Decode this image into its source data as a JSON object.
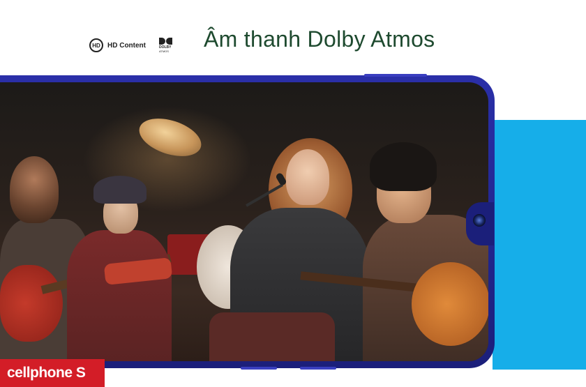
{
  "header": {
    "hd_badge_icon_text": "HD",
    "hd_badge_label": "HD Content",
    "dolby_logo_line1": "DOLBY",
    "dolby_logo_line2": "ATMOS",
    "headline": "Âm thanh Dolby Atmos"
  },
  "brand": {
    "name": "cellphone S",
    "color": "#d31d27"
  },
  "colors": {
    "accent_blue": "#16aee9",
    "phone_frame": "#2a2fa8",
    "headline_text": "#1e4a2f"
  },
  "scene": {
    "icon": "concert-photo"
  }
}
